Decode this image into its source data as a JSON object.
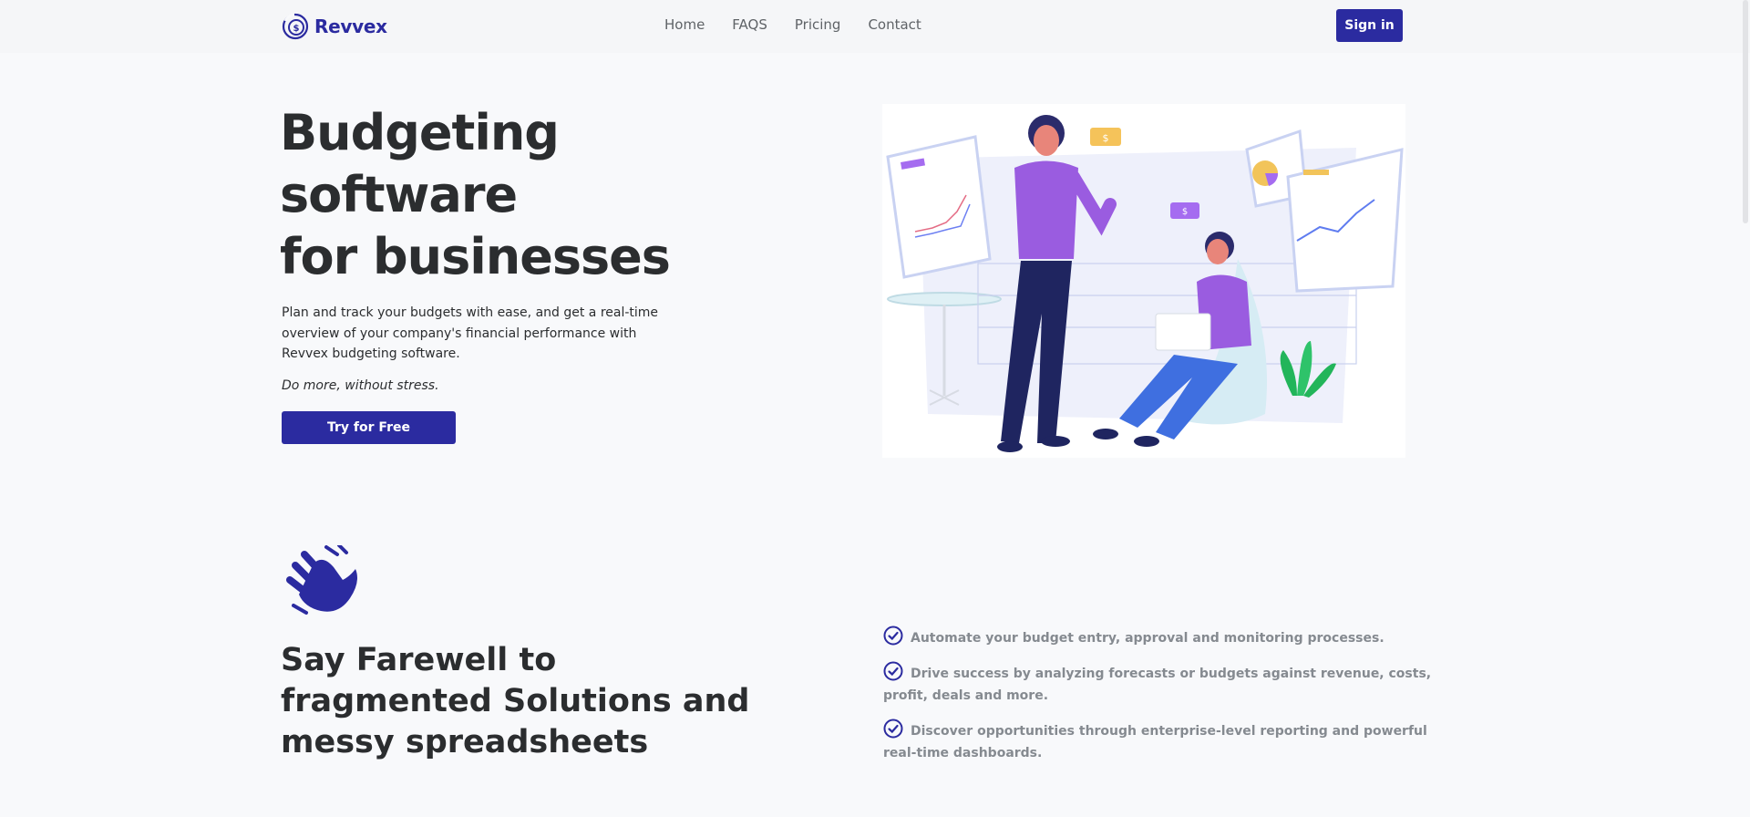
{
  "brand": {
    "name": "Revvex"
  },
  "nav": {
    "links": [
      "Home",
      "FAQS",
      "Pricing",
      "Contact"
    ],
    "signin_label": "Sign in"
  },
  "hero": {
    "title": "Budgeting\nsoftware\nfor businesses",
    "description": "Plan and track your budgets with ease, and get a real-time overview of your company's financial performance with Revvex budgeting software.",
    "tagline": "Do more, without stress.",
    "cta_label": "Try for Free"
  },
  "section": {
    "title": "Say Farewell to\nfragmented Solutions and\nmessy spreadsheets",
    "features": [
      "Automate your budget entry, approval and monitoring processes.",
      "Drive success by analyzing forecasts or budgets against revenue, costs, profit, deals and more.",
      "Discover opportunities through enterprise-level reporting and powerful real-time dashboards."
    ]
  },
  "colors": {
    "primary": "#2b2ba0",
    "accent_purple": "#8b5cf6",
    "text": "#2b2d2f",
    "muted": "#858a90"
  },
  "icons": [
    "revvex-logo-icon",
    "waving-hand-icon",
    "check-circle-icon"
  ]
}
